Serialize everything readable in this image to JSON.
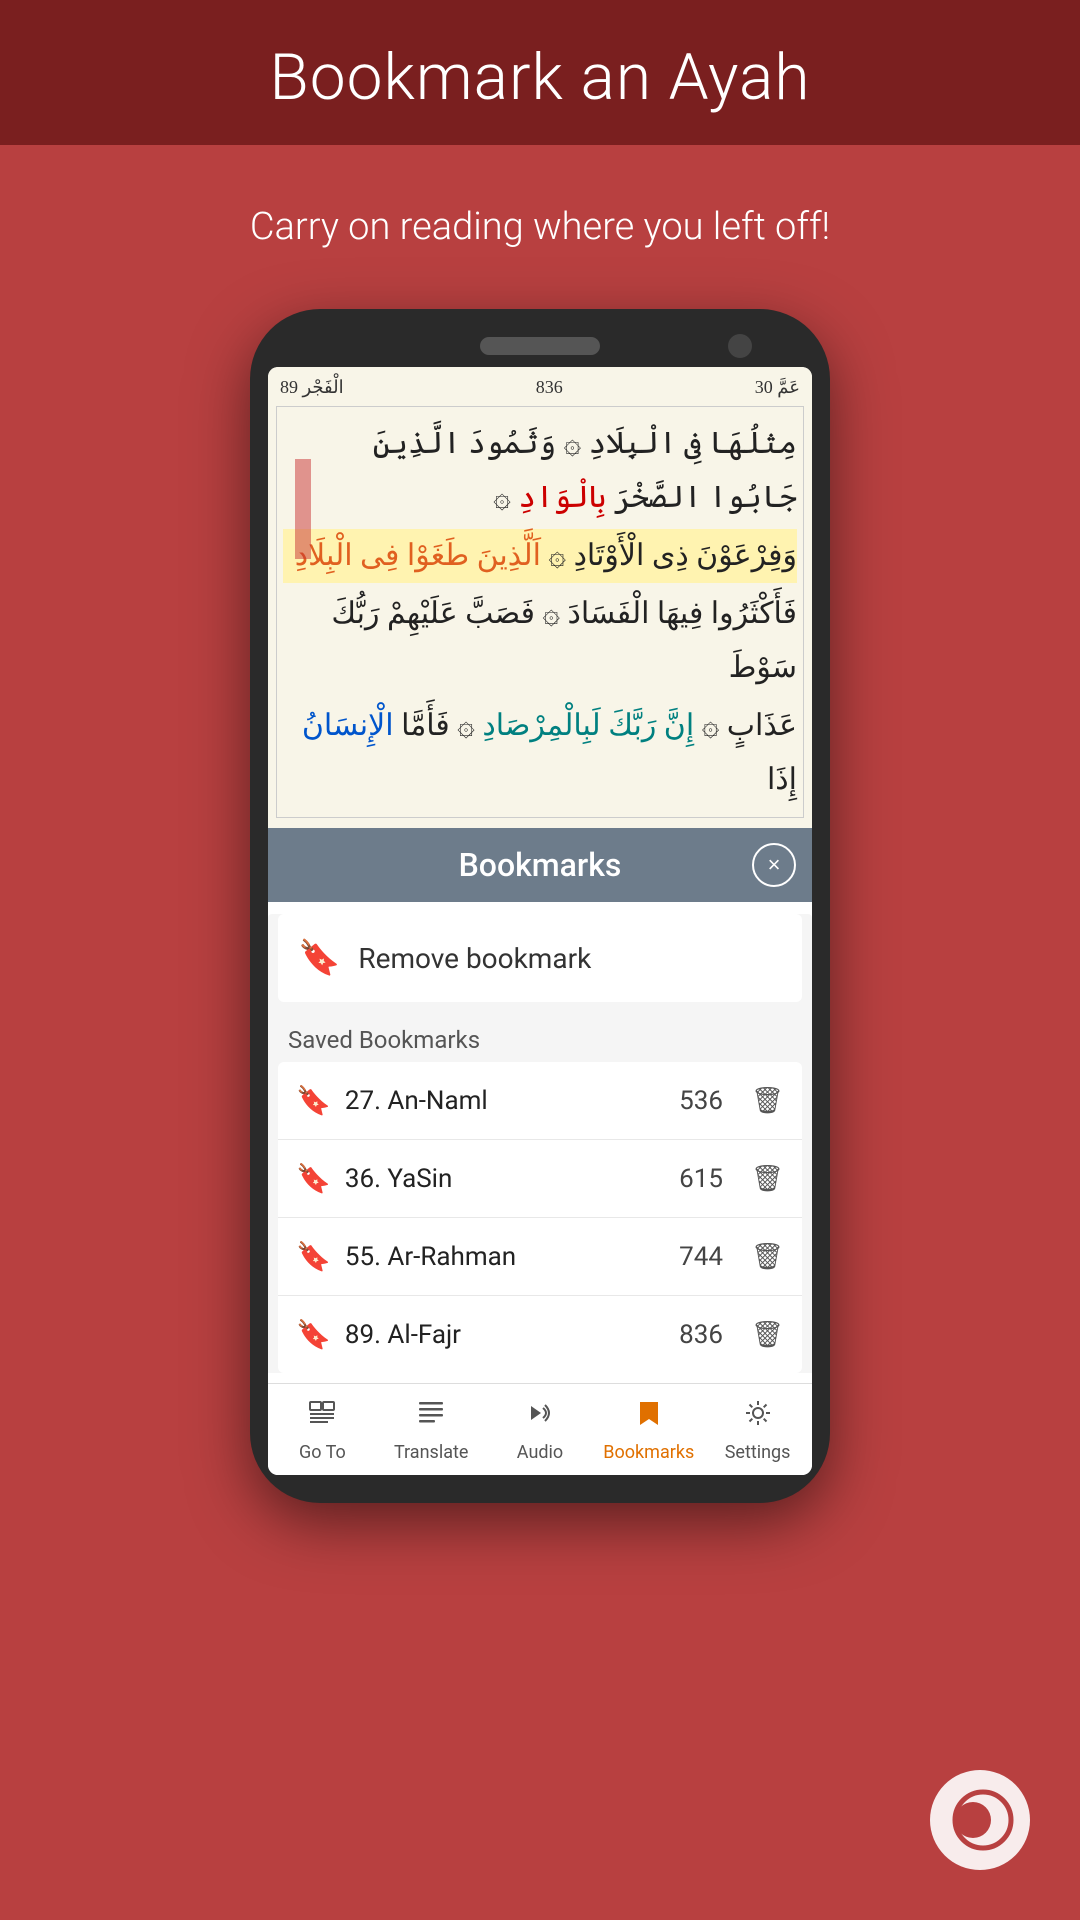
{
  "header": {
    "title": "Bookmark an Ayah",
    "subtitle": "Carry on reading where you left off!"
  },
  "quran_page": {
    "page_num": "836",
    "surah_num": "٨٣٦",
    "juz_label": "30 عَمَّ",
    "surah_label": "89 الْفَجْر",
    "rows": [
      "مِثلُهَا فِى الْبِلَادِ ﻯ وَثَمُودَ الَّذِينَ جَابُوا الصَّخْرَ بِالْوَادِ ﻯ",
      "وَفِرْعَوْنَ ذِى الْأَوْتَادِ ﻱ اَلَّذِينَ طَغَوْا فِى الْبِلَادِ",
      "فَأَكْثَرُوا فِيهَا الْفَسَادَ ﻯ فَصَبَّ عَلَيْهِمْ رَبُّكَ سَوْطَ",
      "عَذَابٍ ﻯ إِنَّ رَبَّكَ لَبِالْمِرْصَادِ ﻯ فَأَمَّا الْإِنسَانُ إِذَا"
    ]
  },
  "bookmarks_panel": {
    "title": "Bookmarks",
    "close_label": "×",
    "remove_label": "Remove bookmark",
    "saved_label": "Saved Bookmarks",
    "items": [
      {
        "name": "27. An-Naml",
        "page": "536"
      },
      {
        "name": "36. YaSin",
        "page": "615"
      },
      {
        "name": "55. Ar-Rahman",
        "page": "744"
      },
      {
        "name": "89. Al-Fajr",
        "page": "836"
      }
    ]
  },
  "bottom_nav": {
    "items": [
      {
        "label": "Go To",
        "icon": "goto",
        "active": false
      },
      {
        "label": "Translate",
        "icon": "translate",
        "active": false
      },
      {
        "label": "Audio",
        "icon": "audio",
        "active": false
      },
      {
        "label": "Bookmarks",
        "icon": "bookmark",
        "active": true
      },
      {
        "label": "Settings",
        "icon": "settings",
        "active": false
      }
    ]
  }
}
